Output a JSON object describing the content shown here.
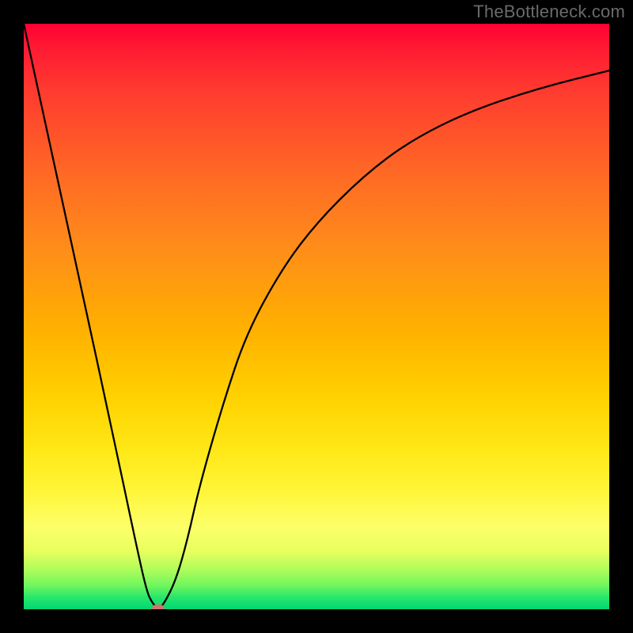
{
  "watermark": "TheBottleneck.com",
  "chart_data": {
    "type": "line",
    "title": "",
    "xlabel": "",
    "ylabel": "",
    "xlim": [
      0,
      100
    ],
    "ylim": [
      0,
      100
    ],
    "series": [
      {
        "name": "curve",
        "x": [
          0,
          5,
          10,
          15,
          19,
          21,
          22,
          23,
          24,
          26,
          28,
          30,
          34,
          38,
          44,
          50,
          58,
          66,
          76,
          88,
          100
        ],
        "values": [
          100,
          77,
          54,
          31,
          12,
          3,
          1,
          0,
          1,
          5,
          12,
          21,
          35,
          47,
          58,
          66,
          74,
          80,
          85,
          89,
          92
        ]
      }
    ],
    "marker": {
      "x": 23,
      "y": 0
    }
  },
  "colors": {
    "curve": "#000000",
    "marker": "#c9786b",
    "background_top": "#ff0033",
    "background_bottom": "#00d874"
  }
}
